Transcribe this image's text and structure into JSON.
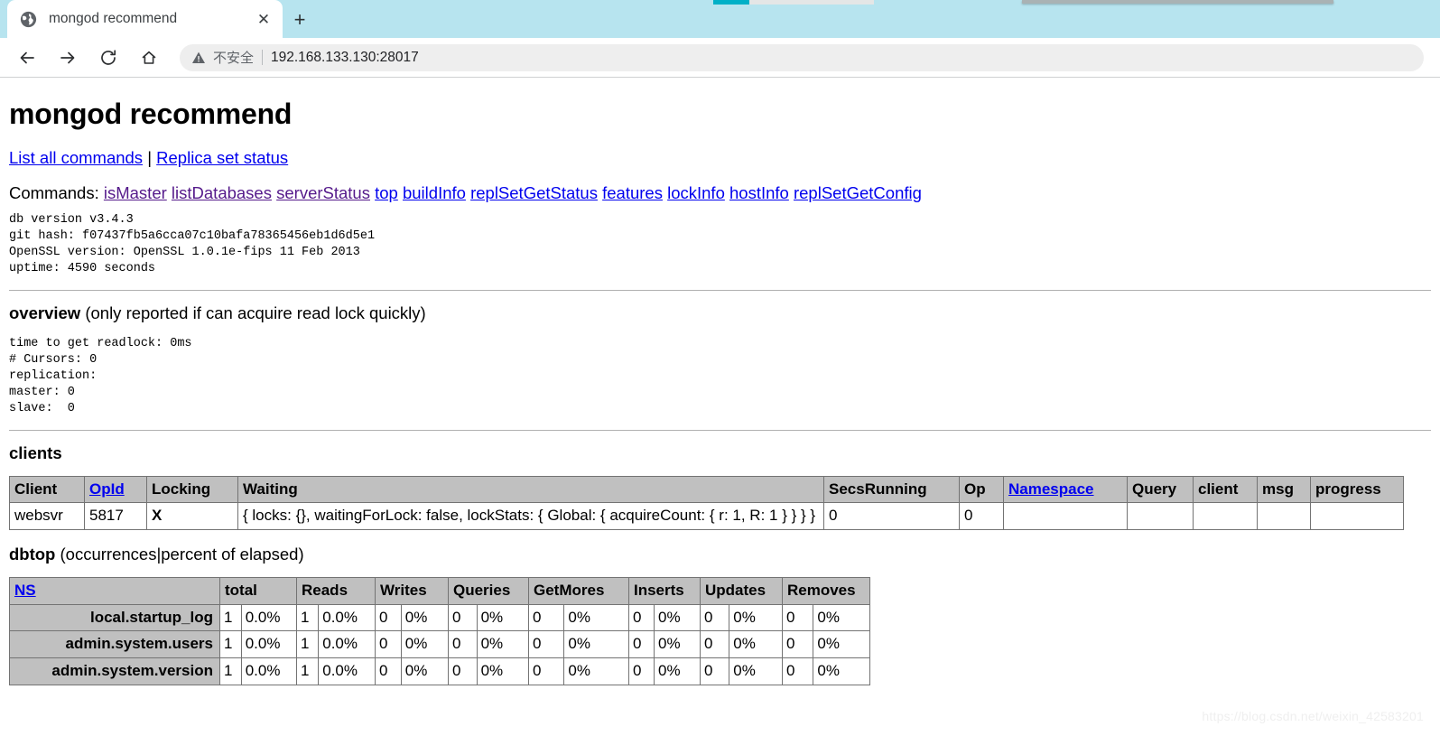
{
  "browser": {
    "tab": {
      "title": "mongod recommend",
      "favicon_name": "globe-icon",
      "close_label": "✕"
    },
    "new_tab_label": "+",
    "toolbar": {
      "back_label": "←",
      "forward_label": "→",
      "reload_label": "⟳",
      "home_label": "⌂",
      "security_label": "不安全",
      "security_icon": "warning-triangle-icon",
      "url": "192.168.133.130:28017"
    }
  },
  "page": {
    "title": "mongod recommend",
    "top_links": [
      {
        "label": "List all commands",
        "visited": false
      },
      {
        "label": "Replica set status",
        "visited": false
      }
    ],
    "top_links_separator": "|",
    "commands_label": "Commands:",
    "commands": [
      {
        "label": "isMaster",
        "visited": true
      },
      {
        "label": "listDatabases",
        "visited": true
      },
      {
        "label": "serverStatus",
        "visited": true
      },
      {
        "label": "top",
        "visited": false
      },
      {
        "label": "buildInfo",
        "visited": false
      },
      {
        "label": "replSetGetStatus",
        "visited": false
      },
      {
        "label": "features",
        "visited": false
      },
      {
        "label": "lockInfo",
        "visited": false
      },
      {
        "label": "hostInfo",
        "visited": false
      },
      {
        "label": "replSetGetConfig",
        "visited": false
      }
    ],
    "version_block": "db version v3.4.3\ngit hash: f07437fb5a6cca07c10bafa78365456eb1d6d5e1\nOpenSSL version: OpenSSL 1.0.1e-fips 11 Feb 2013\nuptime: 4590 seconds",
    "overview": {
      "heading_bold": "overview",
      "heading_rest": " (only reported if can acquire read lock quickly)",
      "block": "time to get readlock: 0ms\n# Cursors: 0\nreplication:\nmaster: 0\nslave:  0"
    },
    "clients": {
      "heading_bold": "clients",
      "heading_rest": "",
      "headers": [
        {
          "label": "Client",
          "link": false
        },
        {
          "label": "OpId",
          "link": true
        },
        {
          "label": "Locking",
          "link": false
        },
        {
          "label": "Waiting",
          "link": false
        },
        {
          "label": "SecsRunning",
          "link": false
        },
        {
          "label": "Op",
          "link": false
        },
        {
          "label": "Namespace",
          "link": true
        },
        {
          "label": "Query",
          "link": false
        },
        {
          "label": "client",
          "link": false
        },
        {
          "label": "msg",
          "link": false
        },
        {
          "label": "progress",
          "link": false
        }
      ],
      "rows": [
        {
          "client": "websvr",
          "opid": "5817",
          "locking": "X",
          "waiting": "{ locks: {}, waitingForLock: false, lockStats: { Global: { acquireCount: { r: 1, R: 1 } } } }",
          "secsrunning": "0",
          "op": "0",
          "namespace": "",
          "query": "",
          "client2": "",
          "msg": "",
          "progress": ""
        }
      ]
    },
    "dbtop": {
      "heading_bold": "dbtop",
      "heading_rest": " (occurrences|percent of elapsed)",
      "ns_header": {
        "label": "NS",
        "link": true
      },
      "metric_headers": [
        "total",
        "Reads",
        "Writes",
        "Queries",
        "GetMores",
        "Inserts",
        "Updates",
        "Removes"
      ],
      "rows": [
        {
          "ns": "local.startup_log",
          "cells": [
            "1",
            "0.0%",
            "1",
            "0.0%",
            "0",
            "0%",
            "0",
            "0%",
            "0",
            "0%",
            "0",
            "0%",
            "0",
            "0%",
            "0",
            "0%"
          ]
        },
        {
          "ns": "admin.system.users",
          "cells": [
            "1",
            "0.0%",
            "1",
            "0.0%",
            "0",
            "0%",
            "0",
            "0%",
            "0",
            "0%",
            "0",
            "0%",
            "0",
            "0%",
            "0",
            "0%"
          ]
        },
        {
          "ns": "admin.system.version",
          "cells": [
            "1",
            "0.0%",
            "1",
            "0.0%",
            "0",
            "0%",
            "0",
            "0%",
            "0",
            "0%",
            "0",
            "0%",
            "0",
            "0%",
            "0",
            "0%"
          ]
        }
      ]
    },
    "watermark": "https://blog.csdn.net/weixin_42583201"
  },
  "colors": {
    "tabstrip": "#b7e4ef",
    "link": "#0000ee",
    "link_visited": "#551a8b",
    "table_header_bg": "#c0c0c0",
    "table_border": "#737373"
  }
}
